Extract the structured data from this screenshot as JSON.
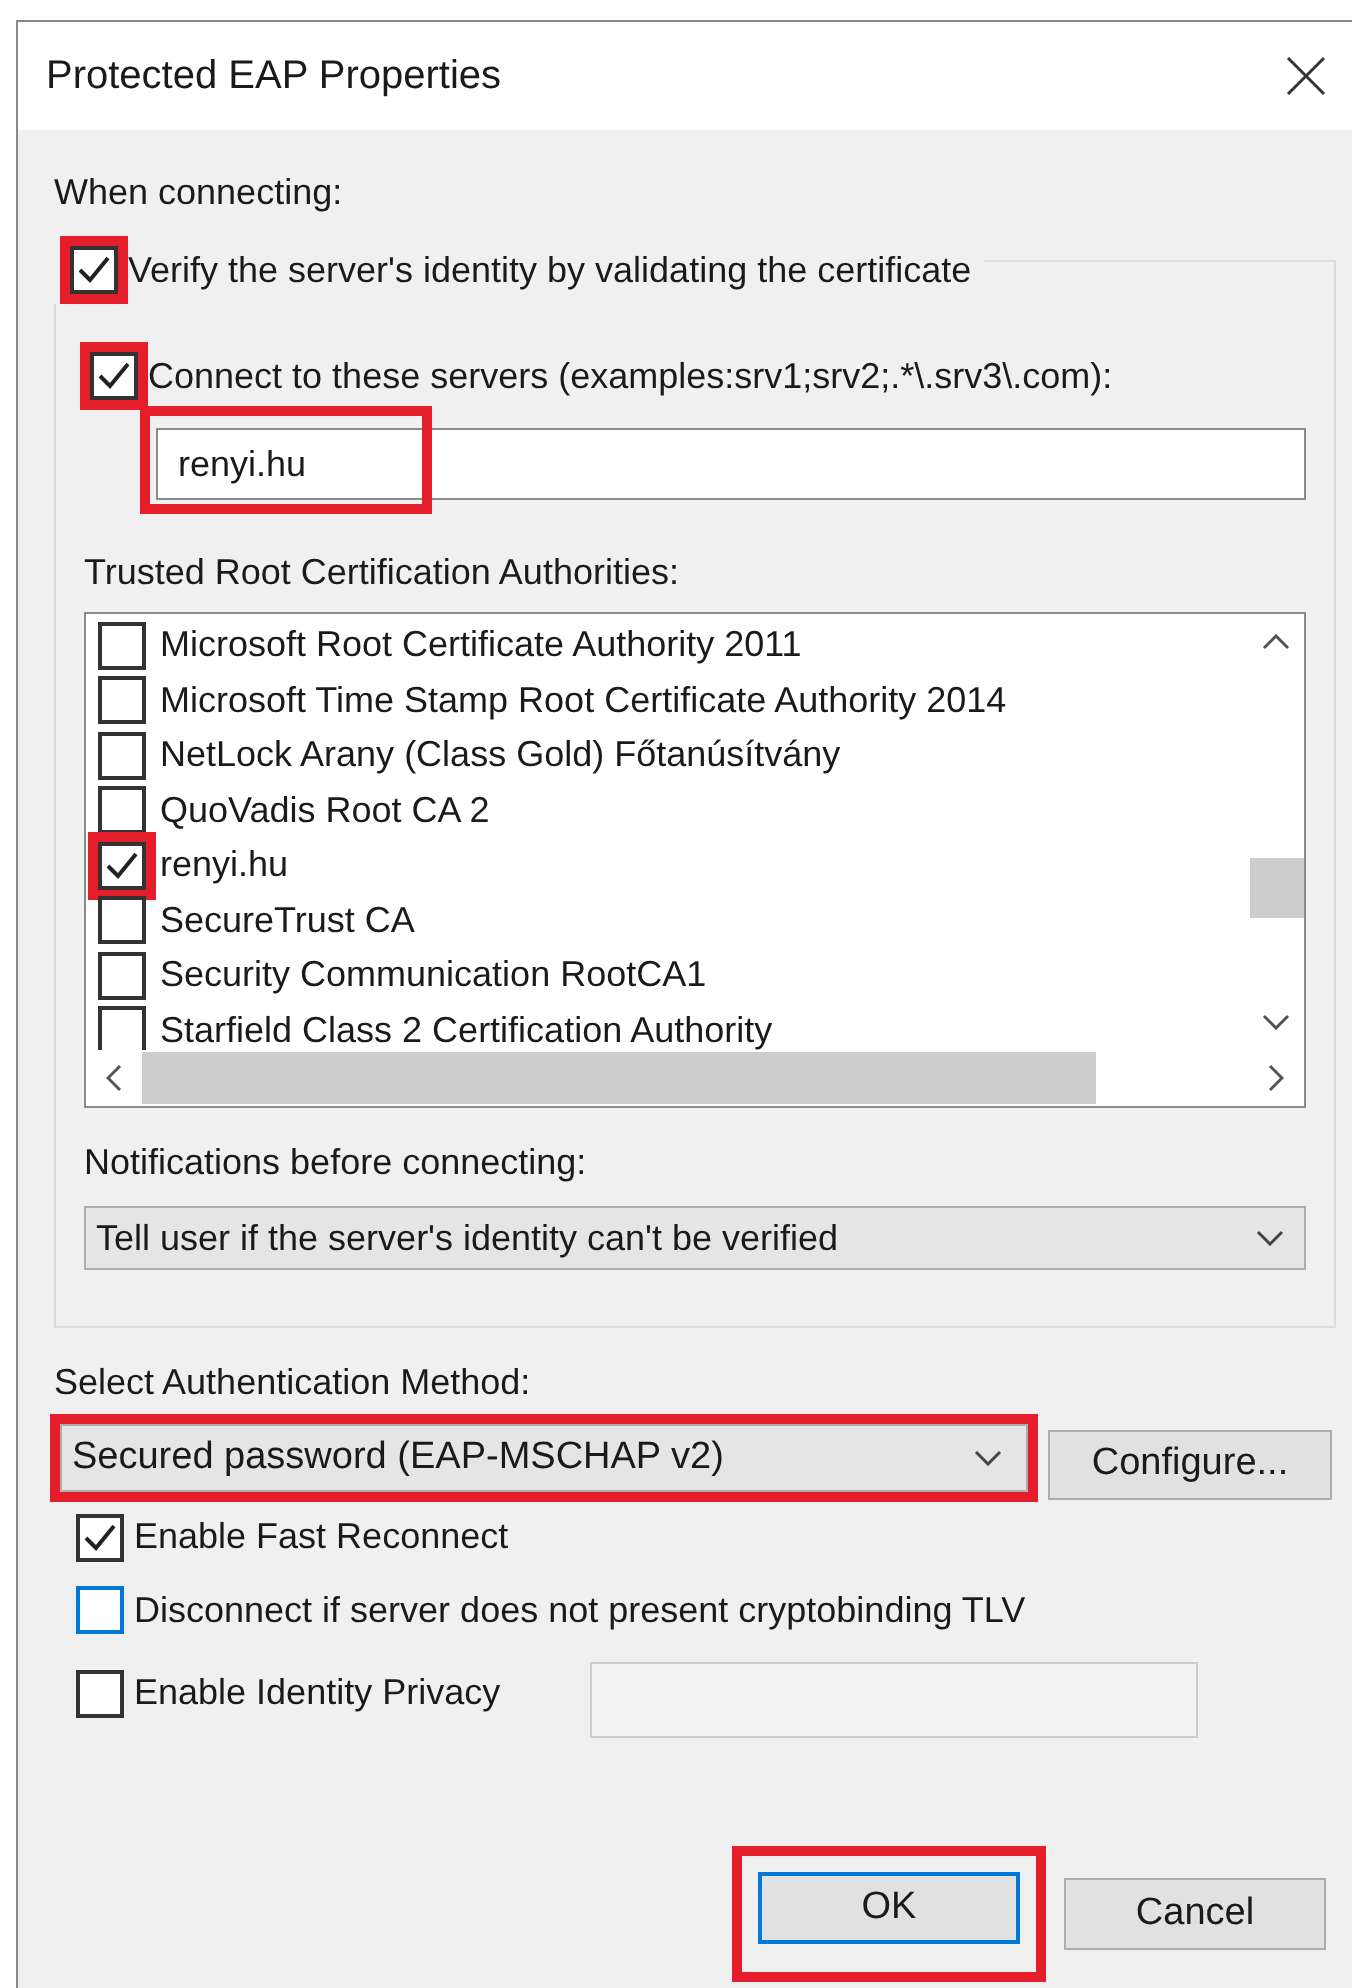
{
  "window": {
    "title": "Protected EAP Properties"
  },
  "when_connecting": {
    "label": "When connecting:"
  },
  "verify": {
    "label": "Verify the server's identity by validating the certificate",
    "checked": true,
    "highlighted": true
  },
  "connect_servers": {
    "label": "Connect to these servers (examples:srv1;srv2;.*\\.srv3\\.com):",
    "checked": true,
    "highlighted": true
  },
  "servers_field": {
    "value": "renyi.hu",
    "highlighted": true
  },
  "trusted_roots": {
    "label": "Trusted Root Certification Authorities:",
    "items": [
      {
        "label": "Microsoft Root Certificate Authority 2011",
        "checked": false,
        "highlighted": false
      },
      {
        "label": "Microsoft Time Stamp Root Certificate Authority 2014",
        "checked": false,
        "highlighted": false
      },
      {
        "label": "NetLock Arany (Class Gold) Főtanúsítvány",
        "checked": false,
        "highlighted": false
      },
      {
        "label": "QuoVadis Root CA 2",
        "checked": false,
        "highlighted": false
      },
      {
        "label": "renyi.hu",
        "checked": true,
        "highlighted": true
      },
      {
        "label": "SecureTrust CA",
        "checked": false,
        "highlighted": false
      },
      {
        "label": "Security Communication RootCA1",
        "checked": false,
        "highlighted": false
      },
      {
        "label": "Starfield Class 2 Certification Authority",
        "checked": false,
        "highlighted": false
      }
    ]
  },
  "notifications": {
    "label": "Notifications before connecting:",
    "value": "Tell user if the server's identity can't be verified"
  },
  "auth_method": {
    "label": "Select Authentication Method:",
    "value": "Secured password (EAP-MSCHAP v2)",
    "highlighted": true
  },
  "configure_button": {
    "label": "Configure..."
  },
  "options": [
    {
      "label": "Enable Fast Reconnect",
      "checked": true,
      "focused": false,
      "kind": "checkbox"
    },
    {
      "label": "Disconnect if server does not present cryptobinding TLV",
      "checked": false,
      "focused": true,
      "kind": "checkbox"
    },
    {
      "label": "Enable Identity Privacy",
      "checked": false,
      "focused": false,
      "kind": "checkbox-field"
    }
  ],
  "buttons": [
    {
      "label": "OK",
      "default": true,
      "highlighted": true
    },
    {
      "label": "Cancel",
      "default": false,
      "highlighted": false
    }
  ]
}
